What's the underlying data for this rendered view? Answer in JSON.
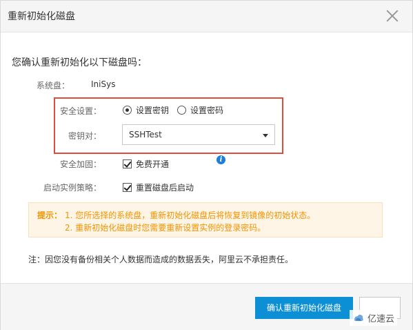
{
  "dialog": {
    "title": "重新初始化磁盘",
    "question": "您确认重新初始化以下磁盘吗：",
    "system_disk": {
      "label": "系统盘：",
      "value": "IniSys"
    },
    "security_settings": {
      "label": "安全设置：",
      "options": [
        {
          "label": "设置密钥",
          "checked": true
        },
        {
          "label": "设置密码",
          "checked": false
        }
      ]
    },
    "key_pair": {
      "label": "密钥对：",
      "value": "SSHTest"
    },
    "security_hardening": {
      "label": "安全加固：",
      "checkbox_label": "免费开通",
      "checked": true
    },
    "start_policy": {
      "label": "启动实例策略：",
      "checkbox_label": "重置磁盘后启动",
      "checked": true
    },
    "tip": {
      "title": "提示：",
      "lines": [
        "1.  您所选择的系统盘，重新初始化磁盘后将恢复到镜像的初始状态。",
        "2.  重新初始化磁盘时您需要重新设置实例的登录密码。"
      ]
    },
    "note": "注：因您没有备份相关个人数据而造成的数据丢失，阿里云不承担责任。",
    "confirm_label": "确认重新初始化磁盘"
  },
  "watermark": {
    "text": "亿速云"
  },
  "colors": {
    "highlight": "#e14b3b",
    "primary": "#0d8fd6",
    "tip_text": "#f39300",
    "tip_background": "#fff5e6"
  },
  "icons": [
    "close-icon",
    "info-icon",
    "caret-down-icon",
    "watermark-logo-icon"
  ]
}
